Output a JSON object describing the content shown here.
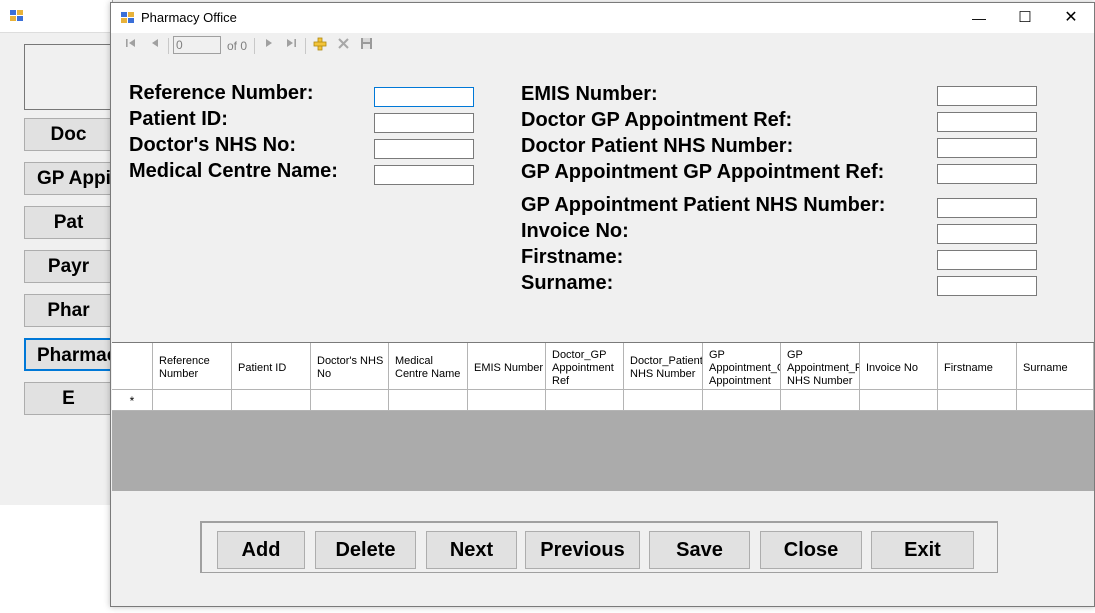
{
  "background_window": {
    "buttons": [
      {
        "label": "Doc"
      },
      {
        "label": "GP Appi"
      },
      {
        "label": "Pat"
      },
      {
        "label": "Payr"
      },
      {
        "label": "Phar"
      },
      {
        "label": "Pharmac"
      },
      {
        "label": "E"
      }
    ]
  },
  "window": {
    "title": "Pharmacy Office",
    "minimize": "—",
    "maximize": "☐",
    "close": "✕"
  },
  "navigator": {
    "position": "0",
    "count": "of 0"
  },
  "form": {
    "left": [
      {
        "label": "Reference Number:",
        "value": ""
      },
      {
        "label": "Patient ID:",
        "value": ""
      },
      {
        "label": "Doctor's NHS No:",
        "value": ""
      },
      {
        "label": "Medical Centre Name:",
        "value": ""
      }
    ],
    "right": [
      {
        "label": "EMIS Number:",
        "value": ""
      },
      {
        "label": "Doctor GP Appointment Ref:",
        "value": ""
      },
      {
        "label": "Doctor Patient NHS Number:",
        "value": ""
      },
      {
        "label": "GP Appointment GP Appointment Ref:",
        "value": ""
      },
      {
        "label": "GP Appointment Patient NHS Number:",
        "value": ""
      },
      {
        "label": "Invoice No:",
        "value": ""
      },
      {
        "label": "Firstname:",
        "value": ""
      },
      {
        "label": "Surname:",
        "value": ""
      }
    ]
  },
  "grid": {
    "columns": [
      "Reference Number",
      "Patient ID",
      "Doctor's NHS No",
      "Medical Centre Name",
      "EMIS Number",
      "Doctor_GP Appointment Ref",
      "Doctor_Patient NHS Number",
      "GP Appointment_GP Appointment",
      "GP Appointment_P NHS Number",
      "Invoice No",
      "Firstname",
      "Surname"
    ],
    "new_row_marker": "*"
  },
  "buttons": {
    "add": "Add",
    "delete": "Delete",
    "next": "Next",
    "previous": "Previous",
    "save": "Save",
    "close": "Close",
    "exit": "Exit"
  },
  "colors": {
    "accent": "#0078d7",
    "grid_background": "#ababab"
  }
}
